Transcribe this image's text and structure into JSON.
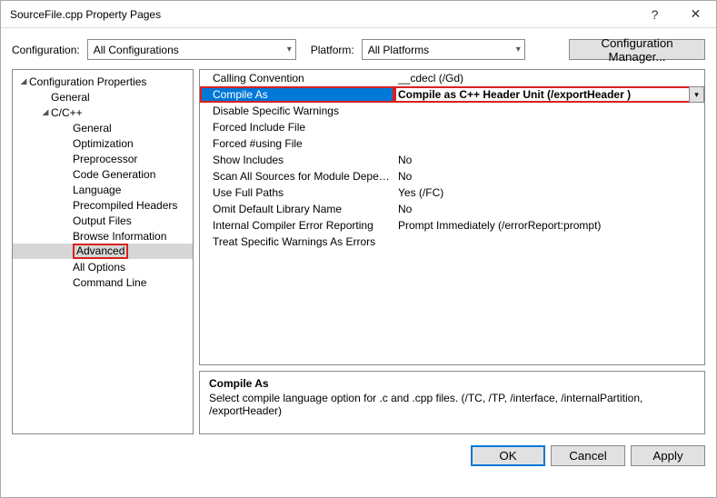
{
  "window": {
    "title": "SourceFile.cpp Property Pages"
  },
  "configRow": {
    "configLabel": "Configuration:",
    "configValue": "All Configurations",
    "platformLabel": "Platform:",
    "platformValue": "All Platforms",
    "managerBtn": "Configuration Manager..."
  },
  "tree": {
    "root": "Configuration Properties",
    "items": [
      {
        "label": "General",
        "indent": 2
      },
      {
        "label": "C/C++",
        "indent": 2,
        "expandable": true
      },
      {
        "label": "General",
        "indent": 4
      },
      {
        "label": "Optimization",
        "indent": 4
      },
      {
        "label": "Preprocessor",
        "indent": 4
      },
      {
        "label": "Code Generation",
        "indent": 4
      },
      {
        "label": "Language",
        "indent": 4
      },
      {
        "label": "Precompiled Headers",
        "indent": 4
      },
      {
        "label": "Output Files",
        "indent": 4
      },
      {
        "label": "Browse Information",
        "indent": 4
      },
      {
        "label": "Advanced",
        "indent": 4,
        "selected": true,
        "highlighted": true
      },
      {
        "label": "All Options",
        "indent": 4
      },
      {
        "label": "Command Line",
        "indent": 4
      }
    ]
  },
  "grid": [
    {
      "label": "Calling Convention",
      "value": "__cdecl (/Gd)"
    },
    {
      "label": "Compile As",
      "value": "Compile as C++ Header Unit (/exportHeader )",
      "highlighted": true
    },
    {
      "label": "Disable Specific Warnings",
      "value": ""
    },
    {
      "label": "Forced Include File",
      "value": ""
    },
    {
      "label": "Forced #using File",
      "value": ""
    },
    {
      "label": "Show Includes",
      "value": "No"
    },
    {
      "label": "Scan All Sources for Module Dependencies",
      "value": "No"
    },
    {
      "label": "Use Full Paths",
      "value": "Yes (/FC)"
    },
    {
      "label": "Omit Default Library Name",
      "value": "No"
    },
    {
      "label": "Internal Compiler Error Reporting",
      "value": "Prompt Immediately (/errorReport:prompt)"
    },
    {
      "label": "Treat Specific Warnings As Errors",
      "value": ""
    }
  ],
  "description": {
    "title": "Compile As",
    "body": "Select compile language option for .c and .cpp files.   (/TC, /TP, /interface, /internalPartition, /exportHeader)"
  },
  "footer": {
    "ok": "OK",
    "cancel": "Cancel",
    "apply": "Apply"
  }
}
